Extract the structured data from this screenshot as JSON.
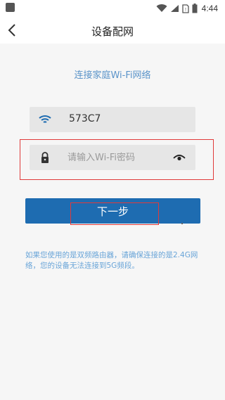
{
  "status_bar": {
    "time": "4:44"
  },
  "header": {
    "title": "设备配网"
  },
  "main": {
    "subtitle": "连接家庭Wi-Fi网络",
    "ssid_value": "573C7",
    "password_placeholder": "请输入Wi-Fi密码",
    "next_button_label": "下一步",
    "note_text": "如果您使用的是双频路由器，请确保连接的是2.4G网络，您的设备无法连接到5G频段。"
  },
  "colors": {
    "accent": "#1e6cb1",
    "subtitle": "#5b94c9",
    "highlight": "#e03a3a"
  },
  "icons": [
    "back-arrow-icon",
    "wifi-icon",
    "lock-icon",
    "eye-icon",
    "battery-icon",
    "signal-icon",
    "sim-icon"
  ]
}
